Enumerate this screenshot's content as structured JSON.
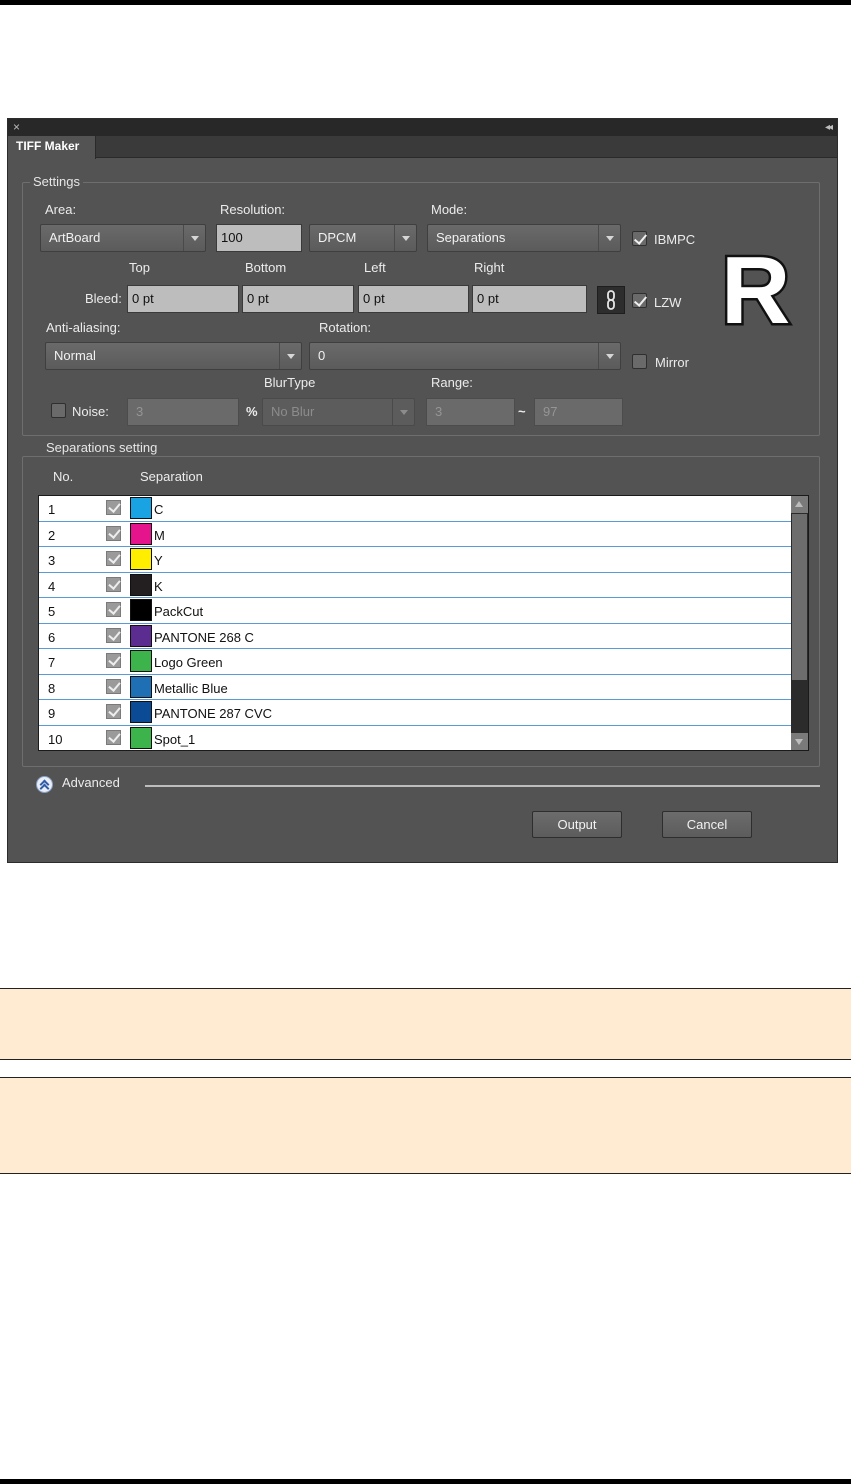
{
  "panel": {
    "title": "TIFF Maker"
  },
  "settings": {
    "legend": "Settings",
    "area_label": "Area:",
    "area_value": "ArtBoard",
    "resolution_label": "Resolution:",
    "resolution_value": "100",
    "resolution_unit": "DPCM",
    "mode_label": "Mode:",
    "mode_value": "Separations",
    "ibmpc_label": "IBMPC",
    "lzw_label": "LZW",
    "mirror_label": "Mirror",
    "bleed_label": "Bleed:",
    "bleed_top_label": "Top",
    "bleed_bottom_label": "Bottom",
    "bleed_left_label": "Left",
    "bleed_right_label": "Right",
    "bleed_top": "0 pt",
    "bleed_bottom": "0 pt",
    "bleed_left": "0 pt",
    "bleed_right": "0 pt",
    "antialias_label": "Anti-aliasing:",
    "antialias_value": "Normal",
    "rotation_label": "Rotation:",
    "rotation_value": "0",
    "noise_label": "Noise:",
    "noise_value": "3",
    "percent": "%",
    "blurtype_label": "BlurType",
    "blurtype_value": "No Blur",
    "range_label": "Range:",
    "range_min": "3",
    "range_sep": "~",
    "range_max": "97",
    "checks": {
      "ibmpc": true,
      "lzw": true,
      "mirror": false,
      "noise": false
    }
  },
  "separations": {
    "legend": "Separations setting",
    "col_no": "No.",
    "col_separation": "Separation",
    "rows": [
      {
        "no": "1",
        "name": "C",
        "color": "#19a3e3"
      },
      {
        "no": "2",
        "name": "M",
        "color": "#e5148c"
      },
      {
        "no": "3",
        "name": "Y",
        "color": "#ffee00"
      },
      {
        "no": "4",
        "name": "K",
        "color": "#231f20"
      },
      {
        "no": "5",
        "name": "PackCut",
        "color": "#000000"
      },
      {
        "no": "6",
        "name": "PANTONE 268 C",
        "color": "#5b2d90"
      },
      {
        "no": "7",
        "name": "Logo Green",
        "color": "#3cb44b"
      },
      {
        "no": "8",
        "name": "Metallic Blue",
        "color": "#1f6fb5"
      },
      {
        "no": "9",
        "name": "PANTONE 287 CVC",
        "color": "#0b4a94"
      },
      {
        "no": "10",
        "name": "Spot_1",
        "color": "#3cb44b"
      }
    ]
  },
  "advanced_label": "Advanced",
  "buttons": {
    "output": "Output",
    "cancel": "Cancel"
  },
  "logo_letter": "R"
}
